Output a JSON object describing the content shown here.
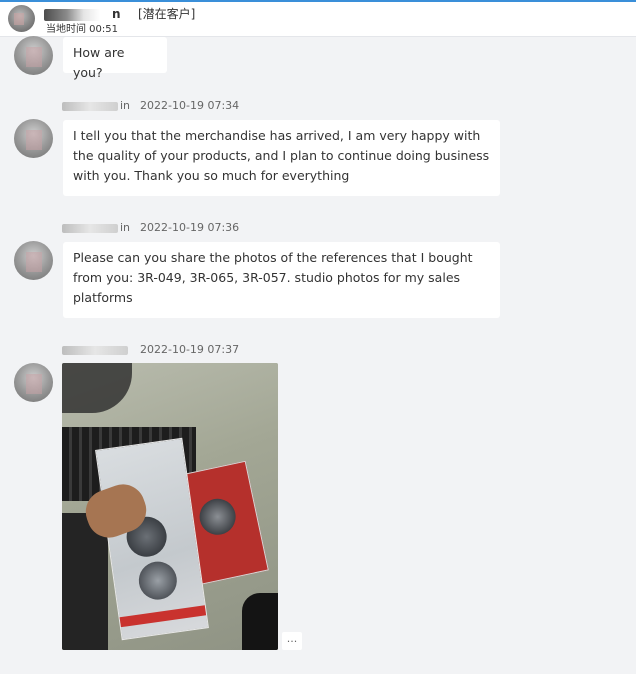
{
  "header": {
    "contact_name_suffix": "n",
    "tag": "[潜在客户]",
    "local_time": "当地时间 00:51"
  },
  "messages": [
    {
      "text": "How are you?"
    },
    {
      "sender_suffix": "in",
      "time": "2022-10-19 07:34",
      "text": "I tell you that the merchandise has arrived, I am very happy with the quality of your products, and I plan to continue doing business with you. Thank you so much for everything"
    },
    {
      "sender_suffix": "in",
      "time": "2022-10-19 07:36",
      "text": "Please can you share the photos of the references that I bought from you: 3R-049, 3R-065, 3R-057. studio photos for my sales platforms"
    },
    {
      "sender_suffix": "",
      "time": "2022-10-19 07:37",
      "type": "image",
      "image_desc_icon": "product-photo"
    }
  ],
  "more_label": "...",
  "colors": {
    "accent": "#3a8fd9",
    "background": "#f2f3f5",
    "bubble": "#ffffff"
  }
}
